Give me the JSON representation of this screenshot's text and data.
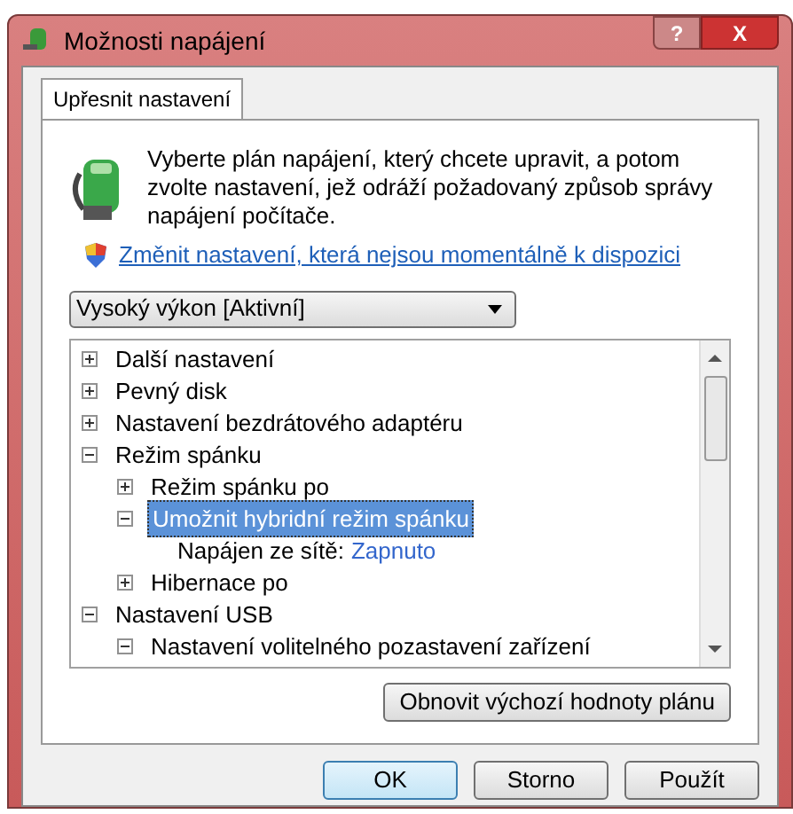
{
  "window": {
    "title": "Možnosti napájení",
    "buttons": [
      "?",
      "X"
    ]
  },
  "tabs": [
    {
      "label": "Upřesnit nastavení",
      "selected": true
    }
  ],
  "intro": {
    "text": "Vyberte plán napájení, který chcete upravit, a potom zvolte nastavení, jež odráží požadovaný způsob správy napájení počítače.",
    "link": "Změnit nastavení, která nejsou momentálně k dispozici"
  },
  "plan_select": {
    "value": "Vysoký výkon [Aktivní]"
  },
  "tree": [
    {
      "kind": "group",
      "label": "Další nastavení",
      "expanded": false,
      "selected": false
    },
    {
      "kind": "group",
      "label": "Pevný disk",
      "expanded": false,
      "selected": false
    },
    {
      "kind": "group",
      "label": "Nastavení bezdrátového adaptéru",
      "expanded": false,
      "selected": false
    },
    {
      "kind": "group",
      "label": "Režim spánku",
      "expanded": true,
      "selected": false,
      "children": [
        {
          "kind": "group",
          "label": "Režim spánku po",
          "expanded": false,
          "selected": false
        },
        {
          "kind": "group",
          "label": "Umožnit hybridní režim spánku",
          "expanded": true,
          "selected": true,
          "children": [
            {
              "kind": "setting",
              "label": "Napájen ze sítě:",
              "value": "Zapnuto",
              "selected": false
            }
          ]
        },
        {
          "kind": "group",
          "label": "Hibernace po",
          "expanded": false,
          "selected": false
        }
      ]
    },
    {
      "kind": "group",
      "label": "Nastavení USB",
      "expanded": true,
      "selected": false,
      "children": [
        {
          "kind": "group",
          "label": "Nastavení volitelného pozastavení zařízení",
          "expanded": true,
          "selected": false
        }
      ]
    }
  ],
  "restore_button": "Obnovit výchozí hodnoty plánu",
  "dialog_buttons": [
    {
      "label": "OK",
      "default": true
    },
    {
      "label": "Storno",
      "default": false
    },
    {
      "label": "Použít",
      "default": false
    }
  ]
}
